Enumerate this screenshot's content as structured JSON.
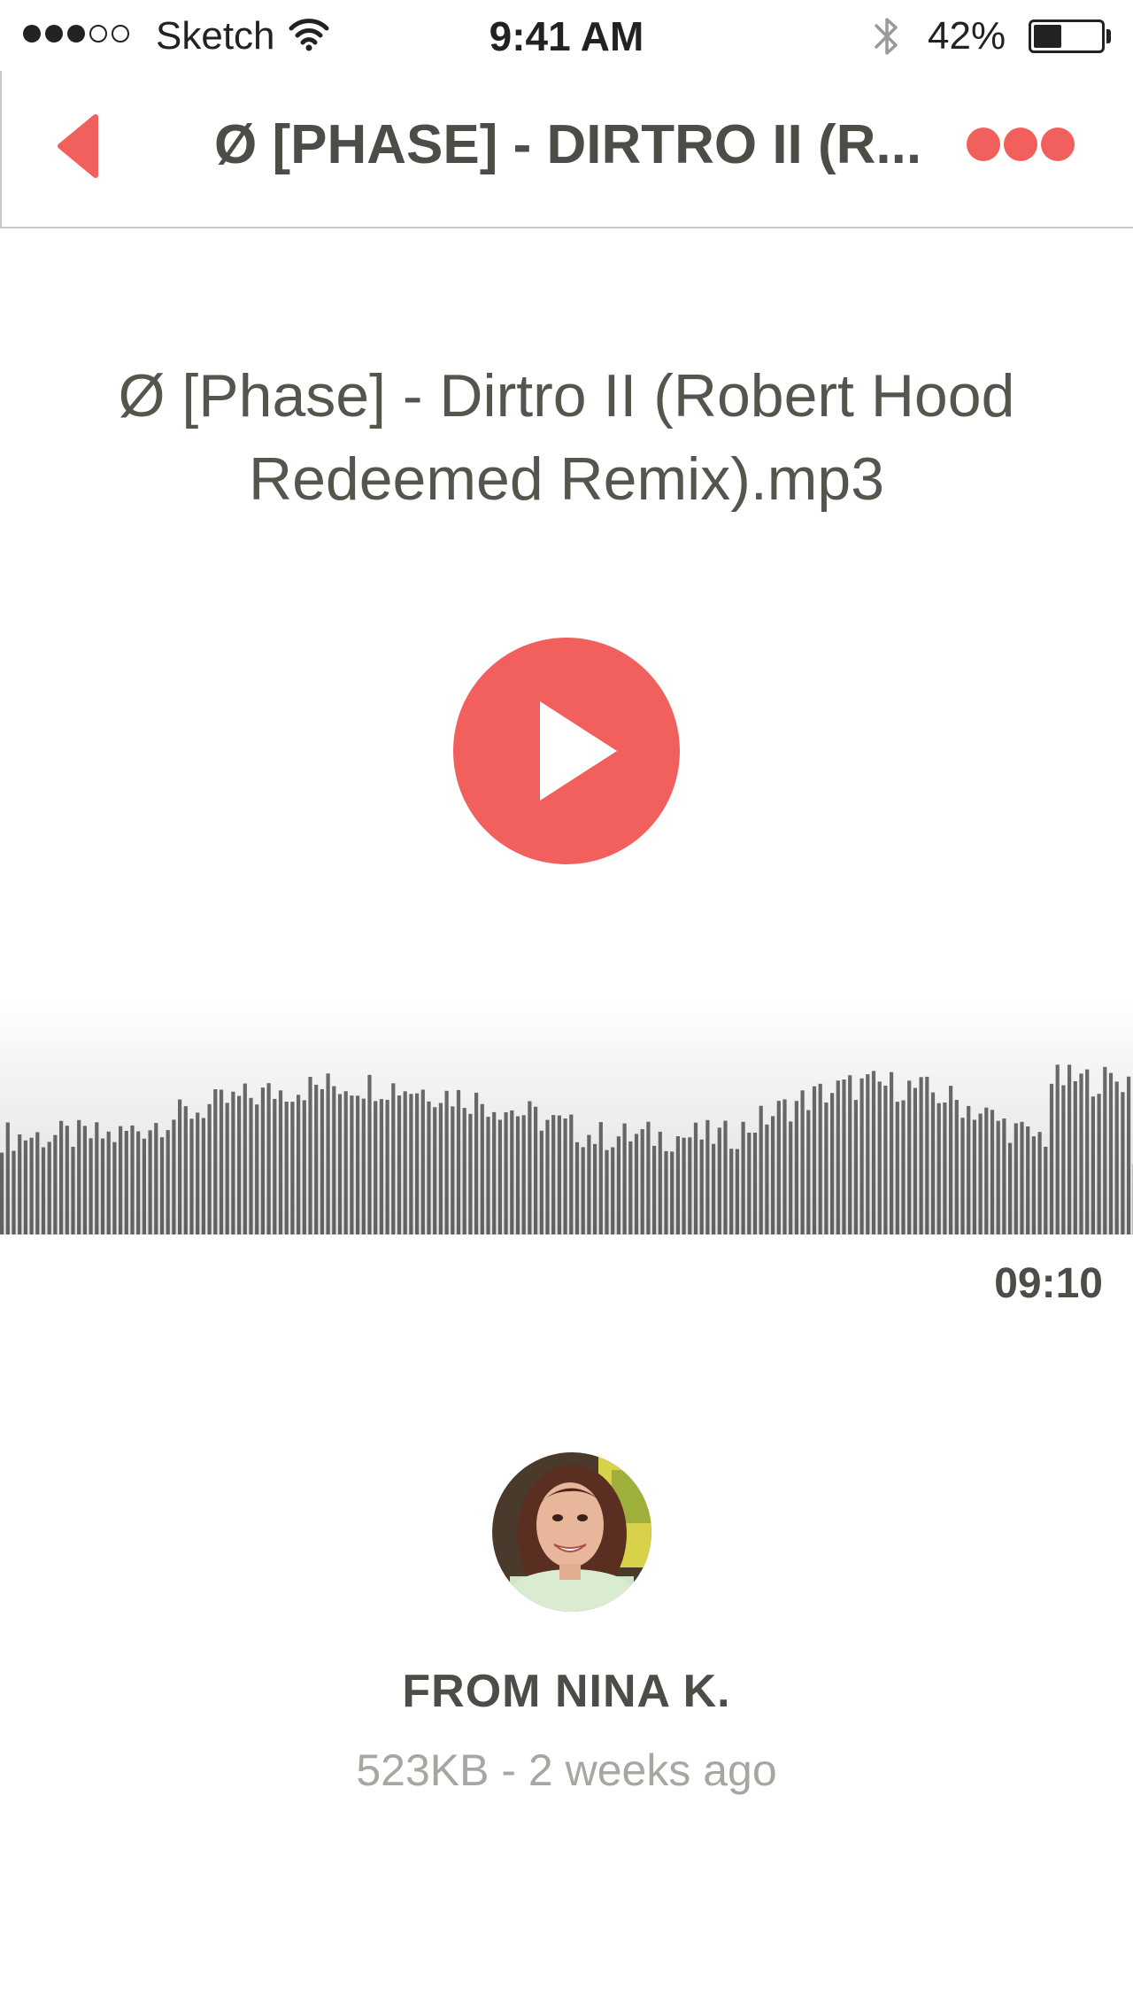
{
  "status_bar": {
    "signal_strength": 3,
    "signal_max": 5,
    "carrier": "Sketch",
    "time": "9:41 AM",
    "battery_percent": "42%",
    "battery_level": 0.42,
    "icons": [
      "wifi-icon",
      "bluetooth-icon",
      "battery-icon"
    ]
  },
  "nav": {
    "back_icon": "chevron-left-icon",
    "title": "Ø [PHASE] - DIRTRO II (R...",
    "more_icon": "more-dots-icon"
  },
  "track": {
    "title_line1": "Ø [Phase] - Dirtro II (Robert Hood",
    "title_line2": "Redeemed Remix).mp3",
    "play_icon": "play-icon",
    "duration": "09:10"
  },
  "sender": {
    "avatar": "avatar-photo",
    "name": "FROM NINA K.",
    "meta": "523KB - 2 weeks ago"
  },
  "colors": {
    "accent": "#f2605e",
    "text_dark": "#4d4d47",
    "text_muted": "#a7a7a2",
    "waveform": "#6e6e6e"
  }
}
